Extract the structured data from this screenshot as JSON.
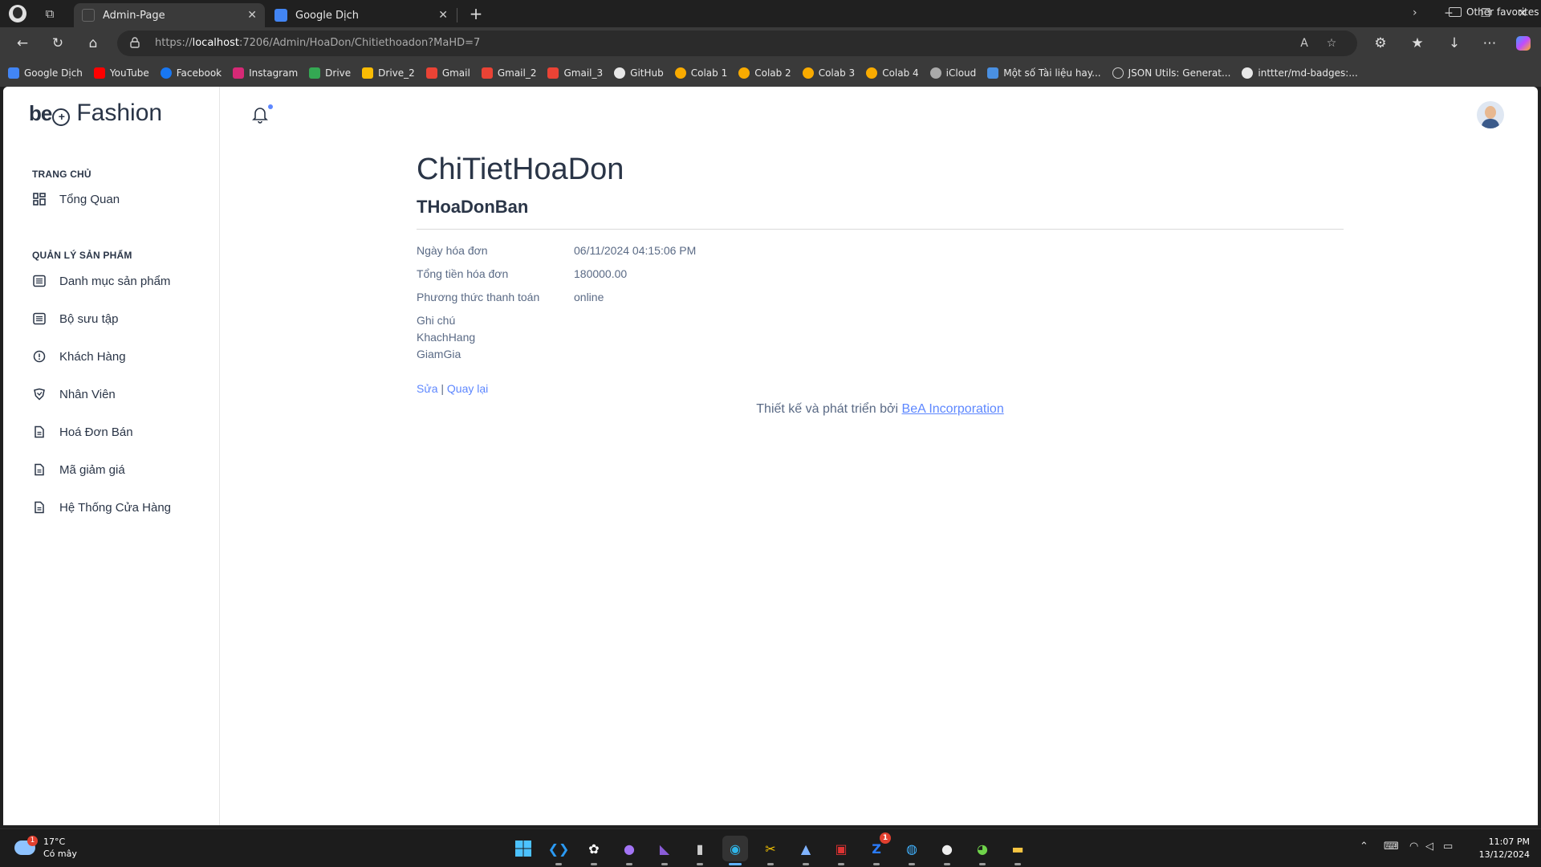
{
  "browser": {
    "tabs": [
      {
        "title": "Admin-Page",
        "active": true
      },
      {
        "title": "Google Dịch",
        "active": false
      }
    ],
    "address": {
      "scheme": "https://",
      "host": "localhost",
      "rest": ":7206/Admin/HoaDon/Chitiethoadon?MaHD=7"
    },
    "favorites": [
      {
        "label": "Google Dịch",
        "color": "#4285f4"
      },
      {
        "label": "YouTube",
        "color": "#ff0000"
      },
      {
        "label": "Facebook",
        "color": "#1877f2"
      },
      {
        "label": "Instagram",
        "color": "#d62976"
      },
      {
        "label": "Drive",
        "color": "#34a853"
      },
      {
        "label": "Drive_2",
        "color": "#fbbc04"
      },
      {
        "label": "Gmail",
        "color": "#ea4335"
      },
      {
        "label": "Gmail_2",
        "color": "#ea4335"
      },
      {
        "label": "Gmail_3",
        "color": "#ea4335"
      },
      {
        "label": "GitHub",
        "color": "#e8e8e8"
      },
      {
        "label": "Colab 1",
        "color": "#f9ab00"
      },
      {
        "label": "Colab 2",
        "color": "#f9ab00"
      },
      {
        "label": "Colab 3",
        "color": "#f9ab00"
      },
      {
        "label": "Colab 4",
        "color": "#f9ab00"
      },
      {
        "label": "iCloud",
        "color": "#aaaaaa"
      },
      {
        "label": "Một số Tài liệu hay...",
        "color": "#4a90e2"
      },
      {
        "label": "JSON Utils: Generat...",
        "color": "#cccccc"
      },
      {
        "label": "inttter/md-badges:...",
        "color": "#e8e8e8"
      }
    ],
    "other_favorites": "Other favorites"
  },
  "sidebar": {
    "logo_mark": "be",
    "logo_brand": "Fashion",
    "section_home": "TRANG CHỦ",
    "overview": "Tổng Quan",
    "section_products": "QUẢN LÝ SẢN PHẨM",
    "items": [
      {
        "label": "Danh mục sản phẩm",
        "icon": "list-icon"
      },
      {
        "label": "Bộ sưu tập",
        "icon": "list-icon"
      },
      {
        "label": "Khách Hàng",
        "icon": "alert-circle-icon"
      },
      {
        "label": "Nhân Viên",
        "icon": "badge-icon"
      },
      {
        "label": "Hoá Đơn Bán",
        "icon": "file-icon"
      },
      {
        "label": "Mã giảm giá",
        "icon": "file-icon"
      },
      {
        "label": "Hệ Thống Cửa Hàng",
        "icon": "file-icon"
      }
    ]
  },
  "main": {
    "title": "ChiTietHoaDon",
    "subtitle": "THoaDonBan",
    "fields": [
      {
        "label": "Ngày hóa đơn",
        "value": "06/11/2024 04:15:06 PM"
      },
      {
        "label": "Tổng tiền hóa đơn",
        "value": "180000.00"
      },
      {
        "label": "Phương thức thanh toán",
        "value": "online"
      }
    ],
    "extra_labels": [
      "Ghi chú",
      "KhachHang",
      "GiamGia"
    ],
    "edit_link": "Sửa",
    "separator": "|",
    "back_link": "Quay lại",
    "footer_text": "Thiết kế và phát triển bởi",
    "footer_link": "BeA Incorporation"
  },
  "taskbar": {
    "weather_temp": "17°C",
    "weather_desc": "Có mây",
    "weather_badge": "1",
    "zalo_badge": "1",
    "time": "11:07 PM",
    "date": "13/12/2024"
  }
}
